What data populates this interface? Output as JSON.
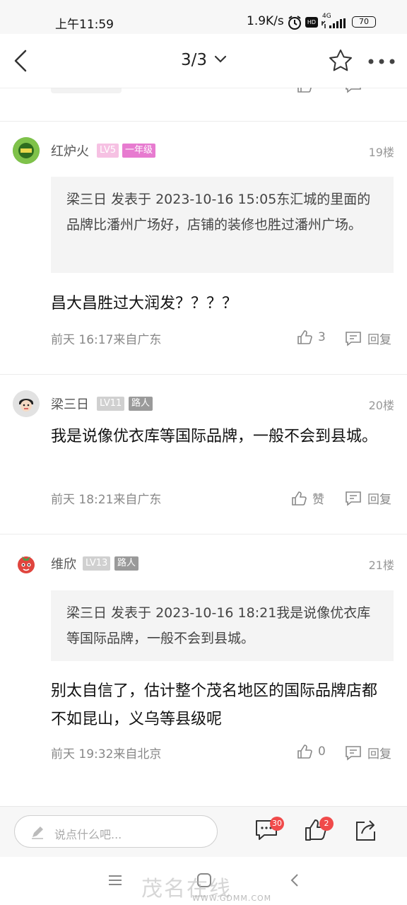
{
  "status_bar": {
    "time": "上午11:59",
    "network_speed": "1.9K/s",
    "hd_label": "HD",
    "signal_label": "4G",
    "battery": "70"
  },
  "nav": {
    "page_indicator": "3/3",
    "icons": [
      "back-arrow-icon",
      "chevron-down-icon",
      "star-icon",
      "more-icon"
    ]
  },
  "posts": [
    {
      "username": "红炉火",
      "level": "LV5",
      "title_badge": "一年级",
      "floor": "19楼",
      "quote": "梁三日 发表于 2023-10-16 15:05东汇城的里面的品牌比潘州广场好，店铺的装修也胜过潘州广场。",
      "content": "昌大昌胜过大润发？？？？",
      "meta": "前天 16:17来自广东",
      "like_label": "3",
      "reply_label": "回复"
    },
    {
      "username": "梁三日",
      "level": "LV11",
      "title_badge": "路人",
      "floor": "20楼",
      "content": "我是说像优衣库等国际品牌，一般不会到县城。",
      "meta": "前天 18:21来自广东",
      "like_label": "赞",
      "reply_label": "回复"
    },
    {
      "username": "维欣",
      "level": "LV13",
      "title_badge": "路人",
      "floor": "21楼",
      "quote": "梁三日 发表于 2023-10-16 18:21我是说像优衣库等国际品牌，一般不会到县城。",
      "content": "别太自信了，估计整个茂名地区的国际品牌店都不如昆山，义乌等县级呢",
      "meta": "前天 19:32来自北京",
      "like_label": "0",
      "reply_label": "回复"
    }
  ],
  "bottom_bar": {
    "comment_placeholder": "说点什么吧...",
    "comment_count": "30",
    "like_count": "2"
  },
  "watermark": {
    "text": "茂名在线",
    "url": "WWW.GDMM.COM"
  },
  "colors": {
    "lv_badge_pink": "#f6c1e3",
    "title_badge_pink": "#e77bd0",
    "lv_badge_gray": "#d0d0d0",
    "title_badge_gray": "#9a9a9a",
    "notification_red": "#f04a4a"
  }
}
